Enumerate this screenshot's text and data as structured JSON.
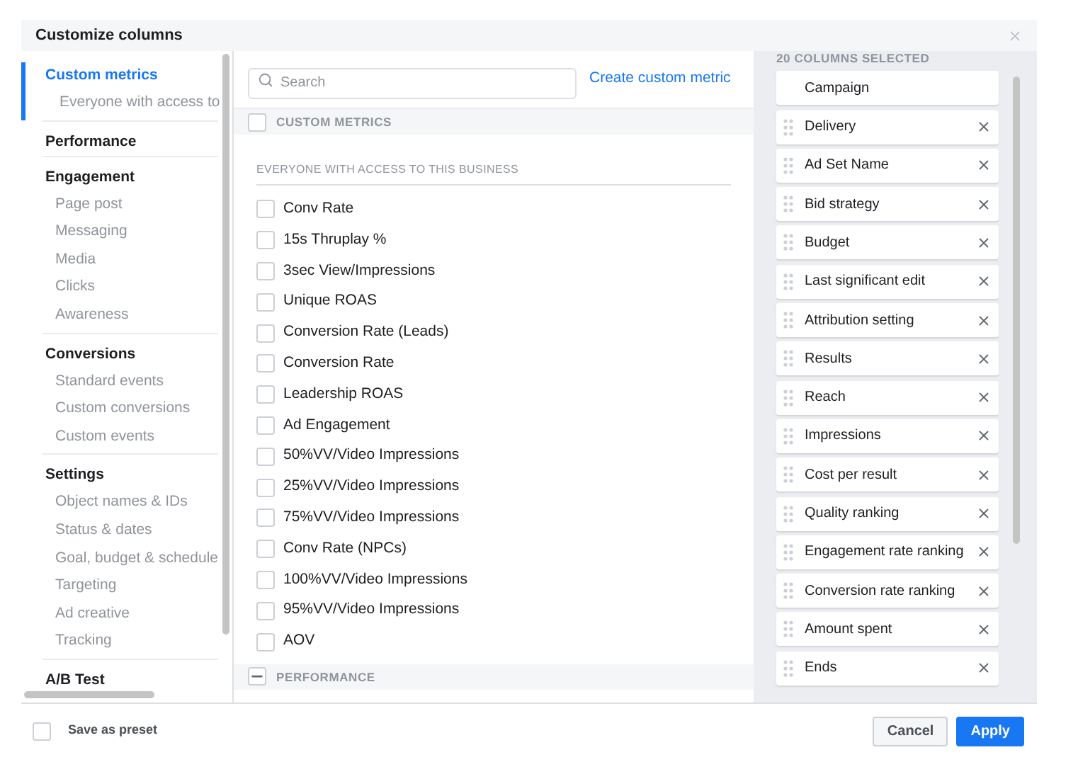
{
  "dialog": {
    "title": "Customize columns"
  },
  "sidebar": {
    "groups": [
      {
        "label": "Custom metrics",
        "selected": true,
        "children": [
          {
            "label": "Everyone with access to",
            "selected": false
          }
        ]
      },
      {
        "label": "Performance",
        "selected": false
      },
      {
        "label": "Engagement",
        "selected": false,
        "children": [
          {
            "label": "Page post",
            "selected": false
          },
          {
            "label": "Messaging",
            "selected": false
          },
          {
            "label": "Media",
            "selected": false
          },
          {
            "label": "Clicks",
            "selected": false
          },
          {
            "label": "Awareness",
            "selected": false
          }
        ]
      },
      {
        "label": "Conversions",
        "selected": false,
        "children": [
          {
            "label": "Standard events",
            "selected": false
          },
          {
            "label": "Custom conversions",
            "selected": false
          },
          {
            "label": "Custom events",
            "selected": false
          }
        ]
      },
      {
        "label": "Settings",
        "selected": false,
        "children": [
          {
            "label": "Object names & IDs",
            "selected": false
          },
          {
            "label": "Status & dates",
            "selected": false
          },
          {
            "label": "Goal, budget & schedule",
            "selected": false
          },
          {
            "label": "Targeting",
            "selected": false
          },
          {
            "label": "Ad creative",
            "selected": false
          },
          {
            "label": "Tracking",
            "selected": false
          }
        ]
      },
      {
        "label": "A/B Test",
        "selected": false
      }
    ]
  },
  "search": {
    "placeholder": "Search"
  },
  "create_link": "Create custom metric",
  "sections": [
    {
      "title": "CUSTOM METRICS",
      "mixed": false,
      "subtitle": "EVERYONE WITH ACCESS TO THIS BUSINESS",
      "metrics": [
        {
          "label": "Conv Rate",
          "checked": false
        },
        {
          "label": "15s Thruplay %",
          "checked": false
        },
        {
          "label": "3sec View/Impressions",
          "checked": false
        },
        {
          "label": "Unique ROAS",
          "checked": false
        },
        {
          "label": "Conversion Rate (Leads)",
          "checked": false
        },
        {
          "label": "Conversion Rate",
          "checked": false
        },
        {
          "label": "Leadership ROAS",
          "checked": false
        },
        {
          "label": "Ad Engagement",
          "checked": false
        },
        {
          "label": "50%VV/Video Impressions",
          "checked": false
        },
        {
          "label": "25%VV/Video Impressions",
          "checked": false
        },
        {
          "label": "75%VV/Video Impressions",
          "checked": false
        },
        {
          "label": "Conv Rate (NPCs)",
          "checked": false
        },
        {
          "label": "100%VV/Video Impressions",
          "checked": false
        },
        {
          "label": "95%VV/Video Impressions",
          "checked": false
        },
        {
          "label": "AOV",
          "checked": false
        }
      ]
    },
    {
      "title": "PERFORMANCE",
      "mixed": true
    }
  ],
  "selected_columns": {
    "heading": "20 COLUMNS SELECTED",
    "items": [
      {
        "label": "Campaign",
        "removable": false
      },
      {
        "label": "Delivery",
        "removable": true
      },
      {
        "label": "Ad Set Name",
        "removable": true
      },
      {
        "label": "Bid strategy",
        "removable": true
      },
      {
        "label": "Budget",
        "removable": true
      },
      {
        "label": "Last significant edit",
        "removable": true
      },
      {
        "label": "Attribution setting",
        "removable": true
      },
      {
        "label": "Results",
        "removable": true
      },
      {
        "label": "Reach",
        "removable": true
      },
      {
        "label": "Impressions",
        "removable": true
      },
      {
        "label": "Cost per result",
        "removable": true
      },
      {
        "label": "Quality ranking",
        "removable": true
      },
      {
        "label": "Engagement rate ranking",
        "removable": true
      },
      {
        "label": "Conversion rate ranking",
        "removable": true
      },
      {
        "label": "Amount spent",
        "removable": true
      },
      {
        "label": "Ends",
        "removable": true
      }
    ]
  },
  "footer": {
    "save_preset": {
      "label": "Save as preset",
      "checked": false
    },
    "buttons": [
      {
        "label": "Cancel",
        "kind": "secondary"
      },
      {
        "label": "Apply",
        "kind": "primary"
      }
    ]
  }
}
